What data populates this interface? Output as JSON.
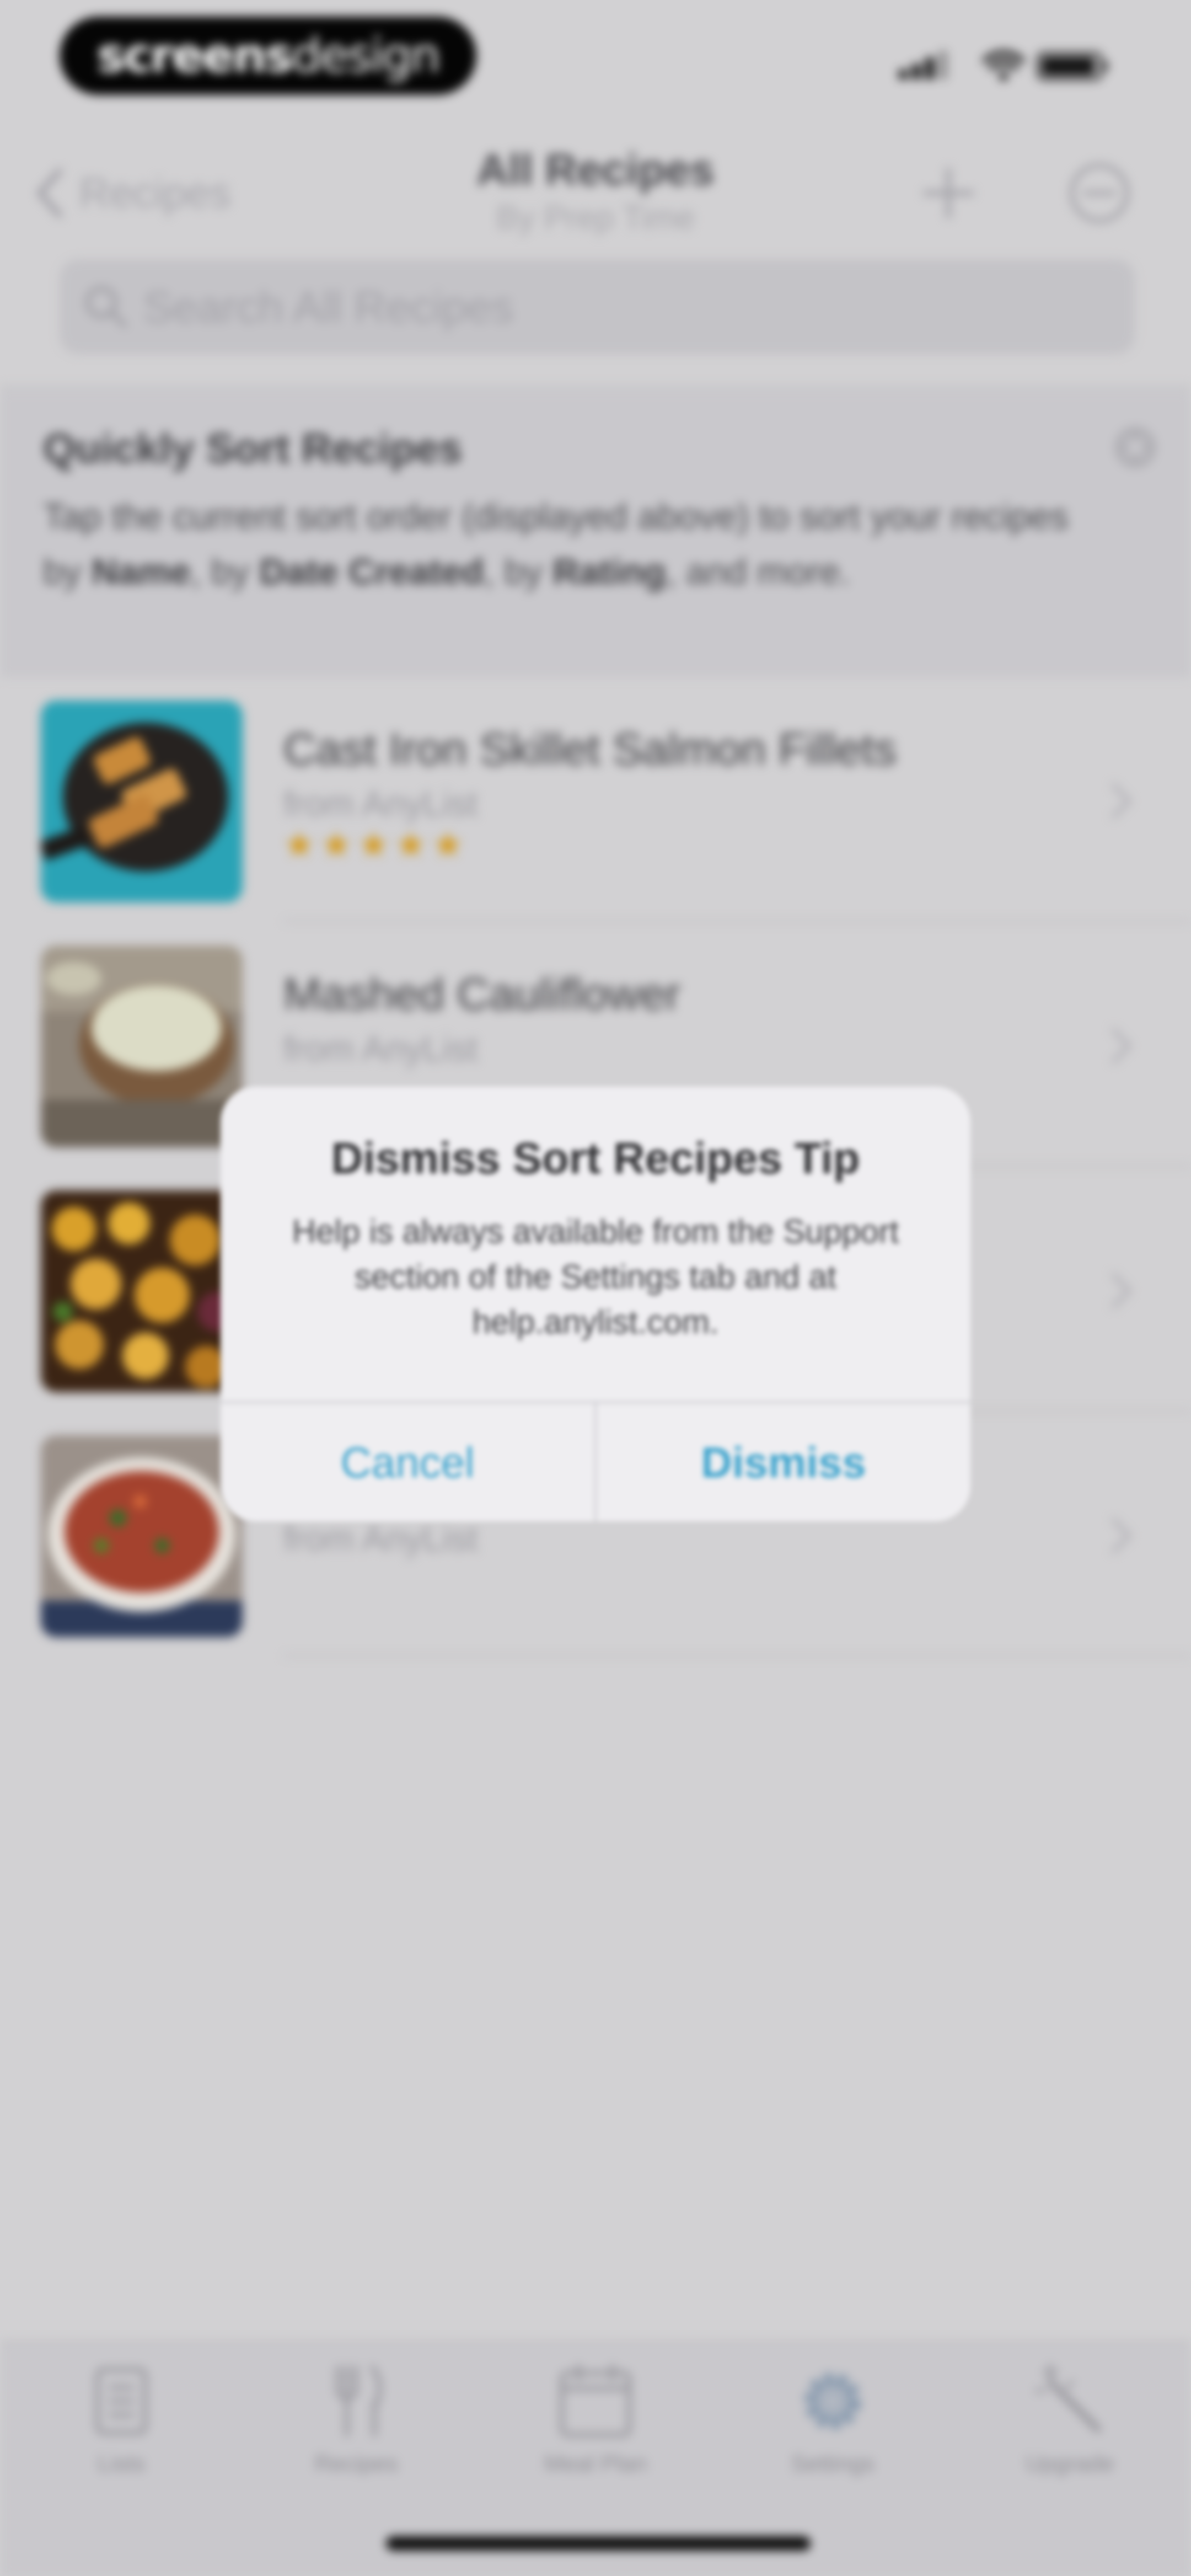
{
  "status_bar": {
    "watermark_bold": "screens",
    "watermark_light": "design"
  },
  "nav": {
    "back_label": "Recipes",
    "title": "All Recipes",
    "subtitle": "By Prep Time"
  },
  "search": {
    "placeholder": "Search All Recipes"
  },
  "tip": {
    "title": "Quickly Sort Recipes",
    "body_prefix": "Tap the current sort order (displayed above) to sort your recipes by ",
    "name": "Name",
    "sep1": ", by ",
    "date_created": "Date Created",
    "sep2": ", by ",
    "rating": "Rating",
    "suffix": ", and more."
  },
  "recipes": [
    {
      "title": "Cast Iron Skillet Salmon Fillets",
      "source": "from AnyList",
      "stars": "★★★★★",
      "rating": 5
    },
    {
      "title": "Mashed Cauliflower",
      "source": "from AnyList"
    },
    {
      "title": "",
      "source": ""
    },
    {
      "title": "",
      "source": "from AnyList"
    }
  ],
  "tabs": [
    {
      "label": "Lists",
      "icon": "lists-icon"
    },
    {
      "label": "Recipes",
      "icon": "fork-knife-icon"
    },
    {
      "label": "Meal Plan",
      "icon": "calendar-icon"
    },
    {
      "label": "Settings",
      "icon": "gear-icon"
    },
    {
      "label": "Upgrade",
      "icon": "magic-wand-icon"
    }
  ],
  "dialog": {
    "title": "Dismiss Sort Recipes Tip",
    "message": "Help is always available from the Support section of the Settings tab and at help.anylist.com.",
    "cancel_label": "Cancel",
    "dismiss_label": "Dismiss"
  },
  "colors": {
    "accent": "#3BA3CD",
    "star": "#D59A1E",
    "dimmed_background": "#D2D1D3"
  }
}
